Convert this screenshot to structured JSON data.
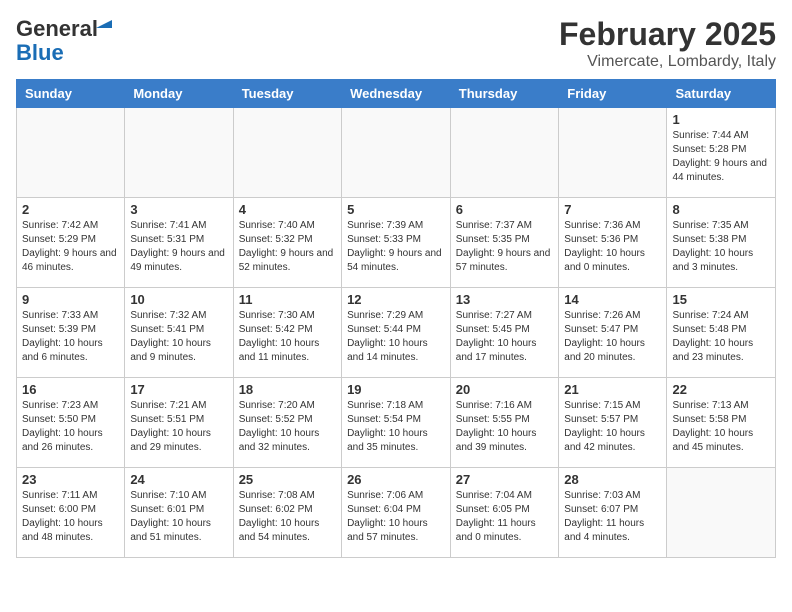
{
  "header": {
    "logo_general": "General",
    "logo_blue": "Blue",
    "month_title": "February 2025",
    "location": "Vimercate, Lombardy, Italy"
  },
  "weekdays": [
    "Sunday",
    "Monday",
    "Tuesday",
    "Wednesday",
    "Thursday",
    "Friday",
    "Saturday"
  ],
  "weeks": [
    [
      {
        "day": "",
        "info": ""
      },
      {
        "day": "",
        "info": ""
      },
      {
        "day": "",
        "info": ""
      },
      {
        "day": "",
        "info": ""
      },
      {
        "day": "",
        "info": ""
      },
      {
        "day": "",
        "info": ""
      },
      {
        "day": "1",
        "info": "Sunrise: 7:44 AM\nSunset: 5:28 PM\nDaylight: 9 hours and 44 minutes."
      }
    ],
    [
      {
        "day": "2",
        "info": "Sunrise: 7:42 AM\nSunset: 5:29 PM\nDaylight: 9 hours and 46 minutes."
      },
      {
        "day": "3",
        "info": "Sunrise: 7:41 AM\nSunset: 5:31 PM\nDaylight: 9 hours and 49 minutes."
      },
      {
        "day": "4",
        "info": "Sunrise: 7:40 AM\nSunset: 5:32 PM\nDaylight: 9 hours and 52 minutes."
      },
      {
        "day": "5",
        "info": "Sunrise: 7:39 AM\nSunset: 5:33 PM\nDaylight: 9 hours and 54 minutes."
      },
      {
        "day": "6",
        "info": "Sunrise: 7:37 AM\nSunset: 5:35 PM\nDaylight: 9 hours and 57 minutes."
      },
      {
        "day": "7",
        "info": "Sunrise: 7:36 AM\nSunset: 5:36 PM\nDaylight: 10 hours and 0 minutes."
      },
      {
        "day": "8",
        "info": "Sunrise: 7:35 AM\nSunset: 5:38 PM\nDaylight: 10 hours and 3 minutes."
      }
    ],
    [
      {
        "day": "9",
        "info": "Sunrise: 7:33 AM\nSunset: 5:39 PM\nDaylight: 10 hours and 6 minutes."
      },
      {
        "day": "10",
        "info": "Sunrise: 7:32 AM\nSunset: 5:41 PM\nDaylight: 10 hours and 9 minutes."
      },
      {
        "day": "11",
        "info": "Sunrise: 7:30 AM\nSunset: 5:42 PM\nDaylight: 10 hours and 11 minutes."
      },
      {
        "day": "12",
        "info": "Sunrise: 7:29 AM\nSunset: 5:44 PM\nDaylight: 10 hours and 14 minutes."
      },
      {
        "day": "13",
        "info": "Sunrise: 7:27 AM\nSunset: 5:45 PM\nDaylight: 10 hours and 17 minutes."
      },
      {
        "day": "14",
        "info": "Sunrise: 7:26 AM\nSunset: 5:47 PM\nDaylight: 10 hours and 20 minutes."
      },
      {
        "day": "15",
        "info": "Sunrise: 7:24 AM\nSunset: 5:48 PM\nDaylight: 10 hours and 23 minutes."
      }
    ],
    [
      {
        "day": "16",
        "info": "Sunrise: 7:23 AM\nSunset: 5:50 PM\nDaylight: 10 hours and 26 minutes."
      },
      {
        "day": "17",
        "info": "Sunrise: 7:21 AM\nSunset: 5:51 PM\nDaylight: 10 hours and 29 minutes."
      },
      {
        "day": "18",
        "info": "Sunrise: 7:20 AM\nSunset: 5:52 PM\nDaylight: 10 hours and 32 minutes."
      },
      {
        "day": "19",
        "info": "Sunrise: 7:18 AM\nSunset: 5:54 PM\nDaylight: 10 hours and 35 minutes."
      },
      {
        "day": "20",
        "info": "Sunrise: 7:16 AM\nSunset: 5:55 PM\nDaylight: 10 hours and 39 minutes."
      },
      {
        "day": "21",
        "info": "Sunrise: 7:15 AM\nSunset: 5:57 PM\nDaylight: 10 hours and 42 minutes."
      },
      {
        "day": "22",
        "info": "Sunrise: 7:13 AM\nSunset: 5:58 PM\nDaylight: 10 hours and 45 minutes."
      }
    ],
    [
      {
        "day": "23",
        "info": "Sunrise: 7:11 AM\nSunset: 6:00 PM\nDaylight: 10 hours and 48 minutes."
      },
      {
        "day": "24",
        "info": "Sunrise: 7:10 AM\nSunset: 6:01 PM\nDaylight: 10 hours and 51 minutes."
      },
      {
        "day": "25",
        "info": "Sunrise: 7:08 AM\nSunset: 6:02 PM\nDaylight: 10 hours and 54 minutes."
      },
      {
        "day": "26",
        "info": "Sunrise: 7:06 AM\nSunset: 6:04 PM\nDaylight: 10 hours and 57 minutes."
      },
      {
        "day": "27",
        "info": "Sunrise: 7:04 AM\nSunset: 6:05 PM\nDaylight: 11 hours and 0 minutes."
      },
      {
        "day": "28",
        "info": "Sunrise: 7:03 AM\nSunset: 6:07 PM\nDaylight: 11 hours and 4 minutes."
      },
      {
        "day": "",
        "info": ""
      }
    ]
  ]
}
